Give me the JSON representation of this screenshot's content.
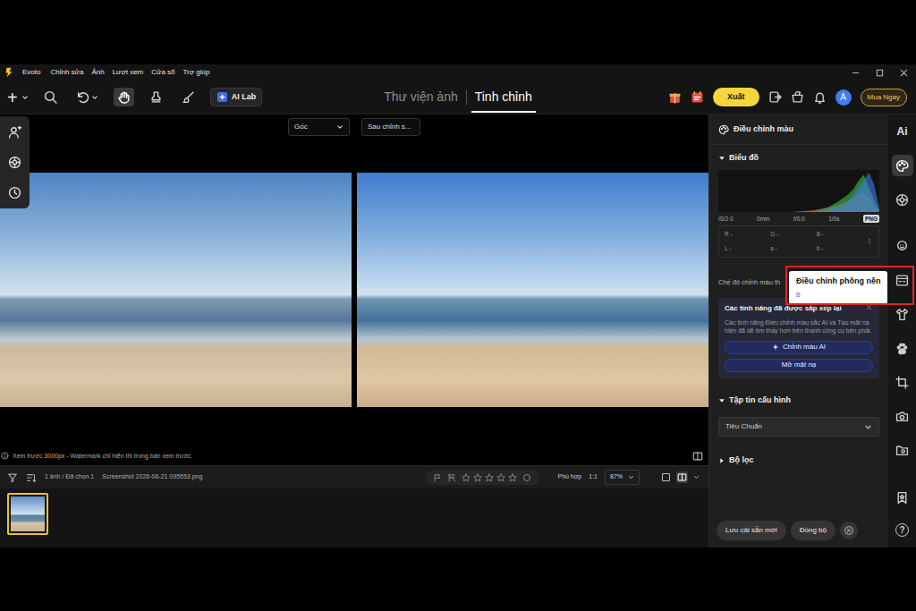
{
  "window": {
    "app": "Evoto"
  },
  "menu": {
    "items": [
      "Chỉnh sửa",
      "Ảnh",
      "Lượt xem",
      "Cửa sổ",
      "Trợ giúp"
    ]
  },
  "toolbar": {
    "add": "+",
    "tools": [
      {
        "kind": "search",
        "selected": false
      },
      {
        "kind": "undo",
        "selected": false
      },
      {
        "kind": "hand",
        "selected": true
      },
      {
        "kind": "stamp",
        "selected": false
      },
      {
        "kind": "brush",
        "selected": false
      }
    ],
    "ai_lab": "AI Lab",
    "tabs": [
      {
        "label": "Thư viện ảnh",
        "selected": false
      },
      {
        "label": "Tinh chỉnh",
        "selected": true
      }
    ],
    "export": "Xuất",
    "avatar": "A",
    "buy": "Mua Ngay"
  },
  "viewer": {
    "before": "Gốc",
    "after": "Sau chỉnh s...",
    "note": {
      "prefix": "Xem trước ",
      "highlight": "3000px",
      "suffix": " - Watermark chỉ hiển thị trong bản xem trước."
    }
  },
  "filmstrip": {
    "count": "1 ảnh / Đã chọn 1",
    "filename": "Screenshot 2026-06-21 095553.png",
    "stars": 0,
    "fit": "Phù hợp",
    "actual": "1:1",
    "zoom": "87%",
    "thumbnails": [
      {
        "selected": true
      }
    ]
  },
  "panel": {
    "title": "Điều chỉnh màu",
    "histogram": {
      "title": "Biểu đồ",
      "expanded": true,
      "series": [
        {
          "color": "#e04848",
          "values": [
            0,
            0,
            0,
            0,
            0,
            0,
            0,
            0,
            0,
            0,
            0,
            0,
            0,
            0,
            0,
            0.01,
            0.02,
            0.03,
            0.04,
            0.06,
            0.08,
            0.1,
            0.13,
            0.17,
            0.22,
            0.28,
            0.36,
            0.44,
            0.5,
            0.38,
            0.15,
            0.02
          ]
        },
        {
          "color": "#3fbf4a",
          "values": [
            0,
            0,
            0,
            0,
            0,
            0,
            0,
            0,
            0,
            0,
            0,
            0,
            0,
            0,
            0,
            0,
            0.01,
            0.02,
            0.03,
            0.05,
            0.08,
            0.12,
            0.18,
            0.26,
            0.35,
            0.45,
            0.58,
            0.8,
            0.95,
            0.62,
            0.3,
            0.05
          ]
        },
        {
          "color": "#3d7de6",
          "values": [
            0,
            0,
            0,
            0,
            0,
            0,
            0,
            0,
            0,
            0,
            0,
            0,
            0,
            0,
            0,
            0,
            0,
            0,
            0.01,
            0.02,
            0.03,
            0.05,
            0.08,
            0.12,
            0.18,
            0.28,
            0.42,
            0.6,
            0.8,
            1.0,
            0.7,
            0.1
          ]
        }
      ],
      "exif": [
        "ISO 0",
        "0mm",
        "f/0.0",
        "1/0s"
      ],
      "format": "PNG",
      "readouts": [
        [
          "R -",
          "G -",
          "B -"
        ],
        [
          "L -",
          "a -",
          "b -"
        ]
      ]
    },
    "mode_label": "Chế độ chỉnh màu th",
    "notice": {
      "title": "Các tính năng đã được sắp xếp lại",
      "body": "Các tính năng Điều chỉnh màu sắc AI và Tạo mặt nạ hiện đã dễ tìm thấy hơn trên thanh công cụ bên phải.",
      "buttons": [
        "Chỉnh màu AI",
        "Mở mặt nạ"
      ]
    },
    "profile": {
      "title": "Tập tin cấu hình",
      "expanded": true,
      "value": "Tiêu Chuẩn"
    },
    "filters": {
      "title": "Bộ lọc",
      "expanded": false
    },
    "footer": {
      "save": "Lưu cài sẵn mới",
      "sync": "Đồng bộ"
    }
  },
  "rail": {
    "items": [
      {
        "kind": "ai",
        "label": "Ai",
        "selected": false
      },
      {
        "kind": "palette",
        "selected": true
      },
      {
        "kind": "aperture",
        "selected": false
      },
      {
        "kind": "face",
        "selected": false
      },
      {
        "kind": "background",
        "selected": false
      },
      {
        "kind": "shirt",
        "selected": false
      },
      {
        "kind": "paw",
        "selected": false
      },
      {
        "kind": "crop",
        "selected": false
      },
      {
        "kind": "camera",
        "selected": false
      },
      {
        "kind": "folder",
        "selected": false
      },
      {
        "kind": "bookmark",
        "selected": false
      },
      {
        "kind": "help",
        "label": "?",
        "selected": false
      }
    ]
  },
  "tooltip": {
    "title": "Điều chỉnh phông nền",
    "shortcut": "B"
  }
}
